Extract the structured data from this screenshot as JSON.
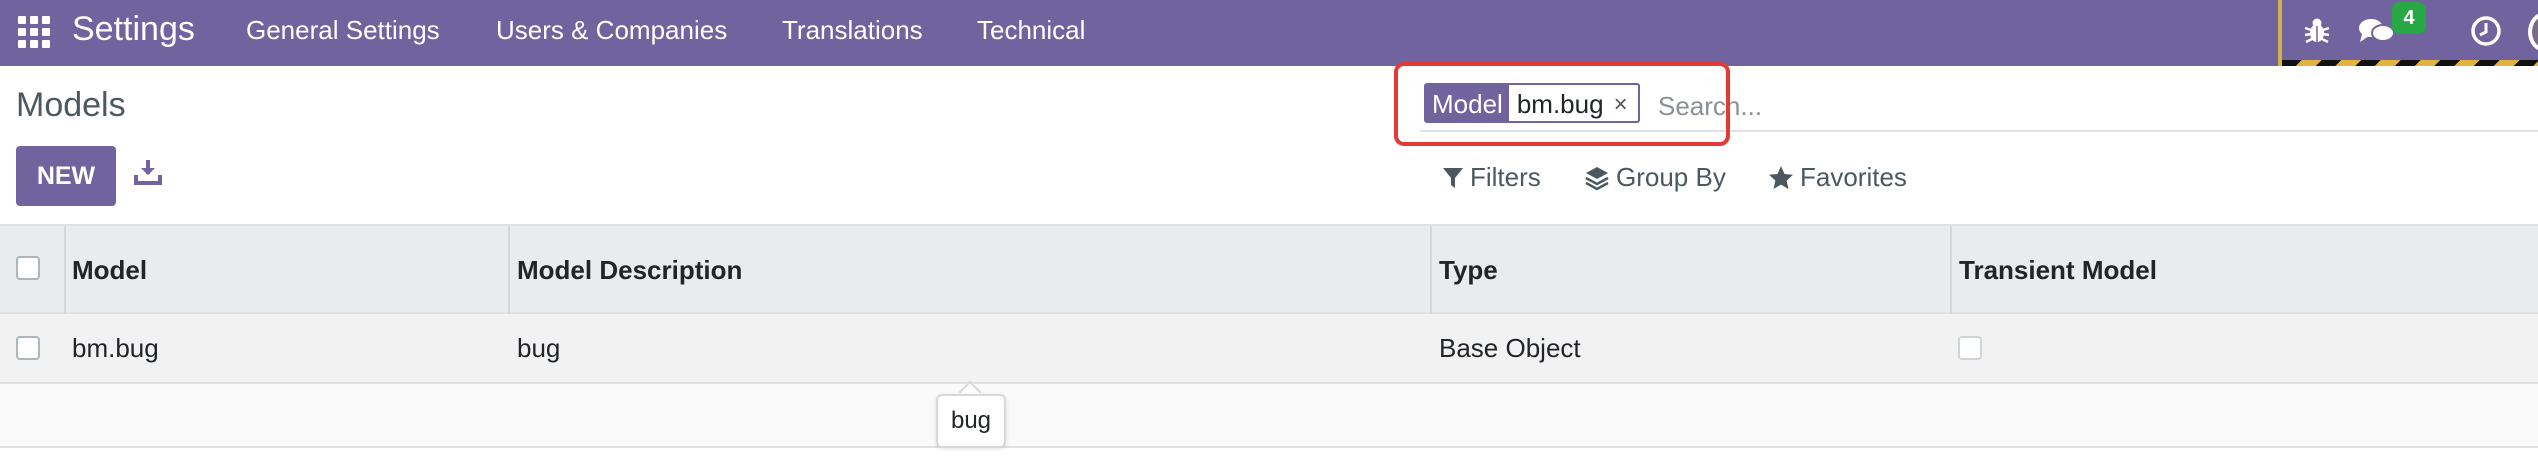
{
  "navbar": {
    "app_name": "Settings",
    "menu": [
      "General Settings",
      "Users & Companies",
      "Translations",
      "Technical"
    ],
    "systray": {
      "messages_badge": "4"
    },
    "bg_color": "#71639e"
  },
  "control_panel": {
    "title": "Models",
    "new_label": "NEW",
    "search": {
      "facet_label": "Model",
      "facet_value": "bm.bug",
      "facet_remove": "×",
      "placeholder": "Search..."
    },
    "filters_label": "Filters",
    "group_by_label": "Group By",
    "favorites_label": "Favorites"
  },
  "table": {
    "columns": [
      "Model",
      "Model Description",
      "Type",
      "Transient Model"
    ],
    "rows": [
      {
        "model": "bm.bug",
        "description": "bug",
        "type": "Base Object",
        "transient": false
      }
    ]
  },
  "tooltip": {
    "text": "bug"
  },
  "icons": [
    "apps-grid-icon",
    "bug-icon",
    "chat-icon",
    "clock-icon",
    "download-icon",
    "filter-icon",
    "layers-icon",
    "star-icon"
  ],
  "colors": {
    "accent": "#71639e",
    "badge": "#28a745",
    "highlight": "#e53935"
  }
}
